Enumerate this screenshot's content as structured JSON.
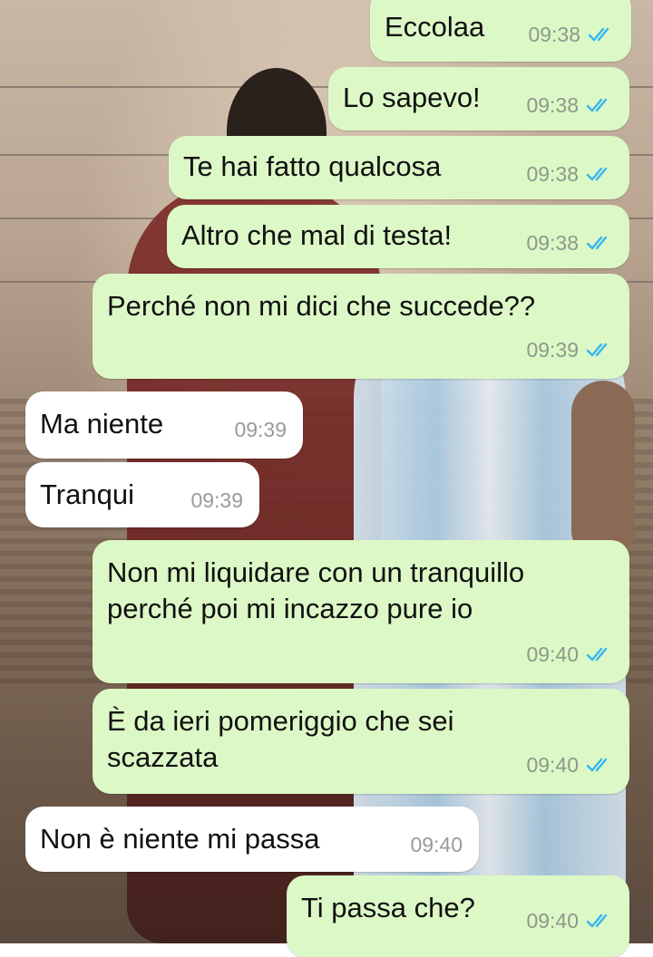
{
  "colors": {
    "outgoing_bubble": "#dcf8c6",
    "incoming_bubble": "#ffffff",
    "read_ticks": "#34b7f1"
  },
  "messages": [
    {
      "direction": "outgoing",
      "text": "Eccolaa",
      "time": "09:38",
      "status": "read"
    },
    {
      "direction": "outgoing",
      "text": "Lo sapevo!",
      "time": "09:38",
      "status": "read"
    },
    {
      "direction": "outgoing",
      "text": "Te hai fatto qualcosa",
      "time": "09:38",
      "status": "read"
    },
    {
      "direction": "outgoing",
      "text": "Altro che mal di testa!",
      "time": "09:38",
      "status": "read"
    },
    {
      "direction": "outgoing",
      "text": "Perché non mi dici che succede??",
      "time": "09:39",
      "status": "read"
    },
    {
      "direction": "incoming",
      "text": "Ma niente",
      "time": "09:39"
    },
    {
      "direction": "incoming",
      "text": "Tranqui",
      "time": "09:39"
    },
    {
      "direction": "outgoing",
      "text": "Non mi liquidare con un tranquillo\nperché poi mi incazzo pure io",
      "time": "09:40",
      "status": "read"
    },
    {
      "direction": "outgoing",
      "text": "È da ieri pomeriggio che sei\nscazzata",
      "time": "09:40",
      "status": "read"
    },
    {
      "direction": "incoming",
      "text": "Non è niente mi passa",
      "time": "09:40"
    },
    {
      "direction": "outgoing",
      "text": "Ti passa che?",
      "time": "09:40",
      "status": "read"
    }
  ]
}
